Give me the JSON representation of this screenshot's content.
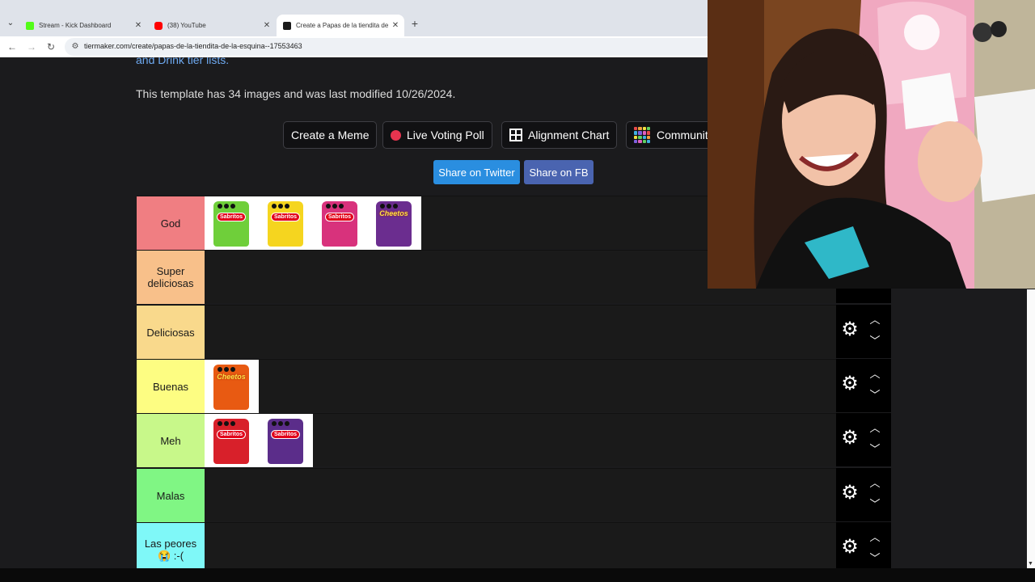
{
  "browser": {
    "tabs": [
      {
        "title": "Stream - Kick Dashboard",
        "color": "#53fc18"
      },
      {
        "title": "(38) YouTube",
        "color": "#ff0000"
      },
      {
        "title": "Create a Papas de la tiendita de",
        "color": "#1a1a1a"
      }
    ],
    "new_tab": "+",
    "url": "tiermaker.com/create/papas-de-la-tiendita-de-la-esquina--17553463"
  },
  "page": {
    "cut_link": "and Drink tier lists.",
    "info": "This template has 34 images and was last modified 10/26/2024.",
    "buttons": {
      "meme": "Create a Meme",
      "poll": "Live Voting Poll",
      "alignment": "Alignment Chart",
      "community": "Community"
    },
    "share_twitter": "Share on Twitter",
    "share_fb": "Share on FB"
  },
  "tiers": [
    {
      "label": "God",
      "color": "#f07e82",
      "items": [
        {
          "name": "Sabritos",
          "kind": "sabritas",
          "bag": "#6fcf3a"
        },
        {
          "name": "Sabritos",
          "kind": "sabritas",
          "bag": "#f5d51f"
        },
        {
          "name": "Sabritos",
          "kind": "sabritas",
          "bag": "#d8327c"
        },
        {
          "name": "Cheetos",
          "kind": "cheetos",
          "bag": "#6b2d8f"
        }
      ]
    },
    {
      "label": "Super deliciosas",
      "color": "#f8c08a",
      "items": []
    },
    {
      "label": "Deliciosas",
      "color": "#f9d98c",
      "items": []
    },
    {
      "label": "Buenas",
      "color": "#fdfd82",
      "items": [
        {
          "name": "Cheetos",
          "kind": "cheetos",
          "bag": "#e85a12"
        }
      ]
    },
    {
      "label": "Meh",
      "color": "#c8f88a",
      "items": [
        {
          "name": "Sabritos",
          "kind": "sabritas",
          "bag": "#d8202a"
        },
        {
          "name": "Sabritos",
          "kind": "sabritas",
          "bag": "#5b2d8a"
        }
      ]
    },
    {
      "label": "Malas",
      "color": "#80f684",
      "items": []
    },
    {
      "label": "Las peores 😭 :-(",
      "color": "#7ff8f8",
      "items": []
    }
  ],
  "icons": {
    "gear": "gear-icon",
    "up": "chevron-up-icon",
    "down": "chevron-down-icon"
  }
}
